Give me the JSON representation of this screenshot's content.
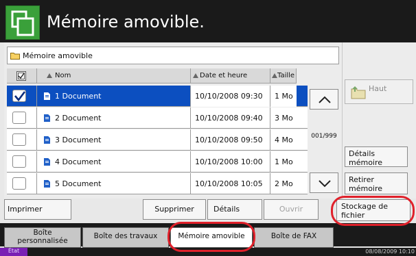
{
  "header": {
    "title": "Mémoire amovible."
  },
  "path": {
    "label": "Mémoire amovible"
  },
  "columns": {
    "name": "Nom",
    "date": "Date et heure",
    "size": "Taille"
  },
  "rows": [
    {
      "name": "1 Document",
      "date": "10/10/2008 09:30",
      "size": "1 Mo",
      "selected": true
    },
    {
      "name": "2 Document",
      "date": "10/10/2008 09:40",
      "size": "3 Mo",
      "selected": false
    },
    {
      "name": "3 Document",
      "date": "10/10/2008 09:50",
      "size": "4 Mo",
      "selected": false
    },
    {
      "name": "4 Document",
      "date": "10/10/2008 10:00",
      "size": "1 Mo",
      "selected": false
    },
    {
      "name": "5 Document",
      "date": "10/10/2008 10:05",
      "size": "2 Mo",
      "selected": false
    }
  ],
  "pager": {
    "text": "001/999"
  },
  "right_buttons": {
    "top": "Haut",
    "details_line1": "Détails",
    "details_line2": "mémoire",
    "remove_line1": "Retirer",
    "remove_line2": "mémoire"
  },
  "actions": {
    "print": "Imprimer",
    "delete": "Supprimer",
    "details": "Détails",
    "open": "Ouvrir",
    "store_line1": "Stockage de",
    "store_line2": "fichier"
  },
  "tabs": {
    "custom_line1": "Boîte",
    "custom_line2": "personnalisée",
    "job": "Boîte des travaux",
    "removable": "Mémoire amovible",
    "fax": "Boîte de FAX"
  },
  "status": {
    "state": "État",
    "datetime": "08/08/2009 10:10"
  },
  "colors": {
    "selection": "#0c4fc0",
    "header_icon": "#3aa03a",
    "highlight": "#e0202a"
  }
}
